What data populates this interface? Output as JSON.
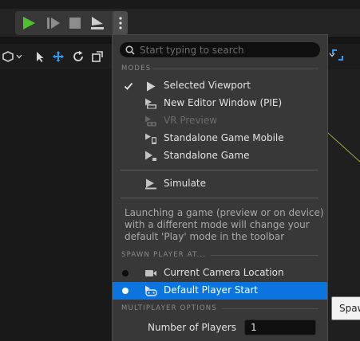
{
  "colors": {
    "accent": "#0c74df",
    "play_green": "#4fc22e",
    "menu_bg": "#383838",
    "viewport_grid_line": "#a7a93d",
    "tooltip_bg": "#f2f2f2"
  },
  "toolbar": {
    "play_icon": "play-icon",
    "advance_frame_icon": "advance-frame-icon",
    "stop_icon": "stop-icon",
    "eject_icon": "eject-icon",
    "more_icon": "vertical-ellipsis-icon"
  },
  "menu": {
    "search_placeholder": "Start typing to search",
    "modes_header": "MODES",
    "modes": [
      {
        "label": "Selected Viewport",
        "icon": "play-icon",
        "checked": true,
        "enabled": true
      },
      {
        "label": "New Editor Window (PIE)",
        "icon": "new-window-icon",
        "checked": false,
        "enabled": true
      },
      {
        "label": "VR Preview",
        "icon": "vr-headset-icon",
        "checked": false,
        "enabled": false
      },
      {
        "label": "Standalone Game Mobile",
        "icon": "mobile-icon",
        "checked": false,
        "enabled": true
      },
      {
        "label": "Standalone Game",
        "icon": "standalone-icon",
        "checked": false,
        "enabled": true
      }
    ],
    "simulate": {
      "label": "Simulate",
      "icon": "simulate-icon"
    },
    "info_text": "Launching a game (preview or on device) with a different mode will change your default 'Play' mode in the toolbar",
    "spawn_header": "SPAWN PLAYER AT...",
    "spawn_options": [
      {
        "label": "Current Camera Location",
        "icon": "camera-icon",
        "selected": false
      },
      {
        "label": "Default Player Start",
        "icon": "gamepad-icon",
        "selected": true
      }
    ],
    "multiplayer_header": "MULTIPLAYER OPTIONS",
    "players_label": "Number of Players",
    "players_value": "1"
  },
  "tooltip": {
    "text": "Spawn"
  }
}
